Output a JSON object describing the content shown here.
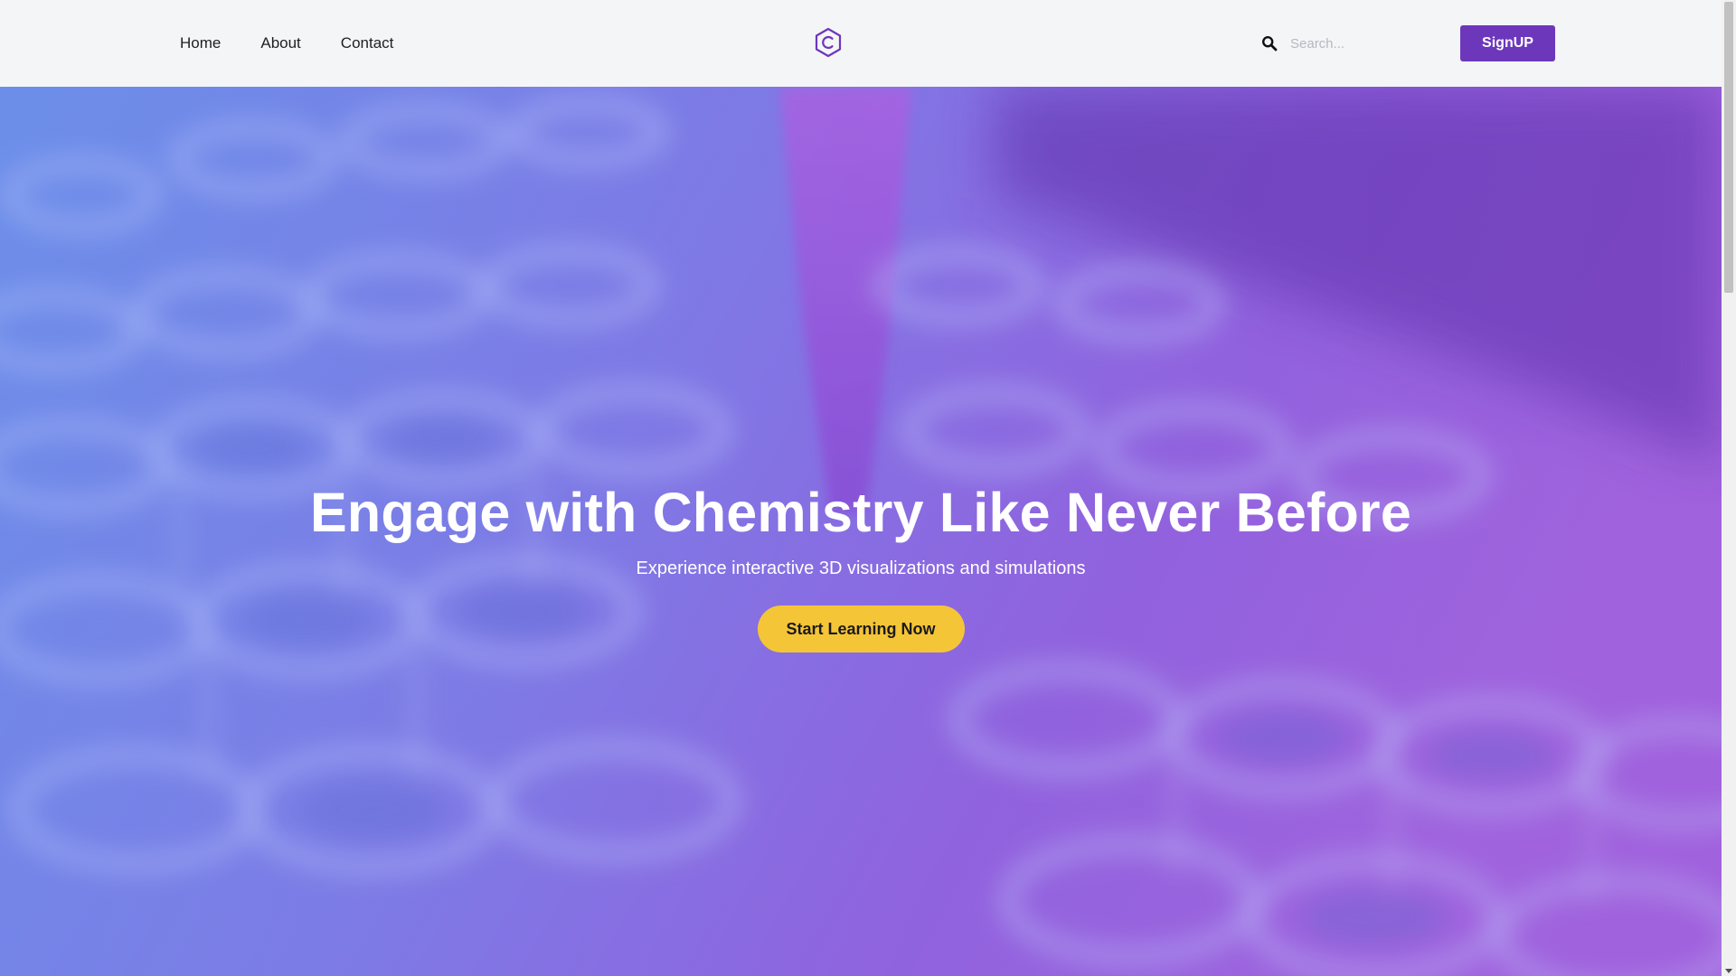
{
  "nav": {
    "links": [
      {
        "label": "Home"
      },
      {
        "label": "About"
      },
      {
        "label": "Contact"
      }
    ],
    "logo_icon": "hexagon-c-logo-icon",
    "search": {
      "placeholder": "Search...",
      "value": "",
      "icon": "search-icon"
    },
    "signup_label": "SignUP"
  },
  "hero": {
    "title": "Engage with Chemistry Like Never Before",
    "subtitle": "Experience interactive 3D visualizations and simulations",
    "cta_label": "Start Learning Now"
  },
  "colors": {
    "accent_purple": "#6d37bc",
    "cta_yellow": "#f5c538",
    "nav_bg": "#f4f5f7",
    "hero_blue": "#6c8de6",
    "hero_violet": "#a066dc"
  }
}
